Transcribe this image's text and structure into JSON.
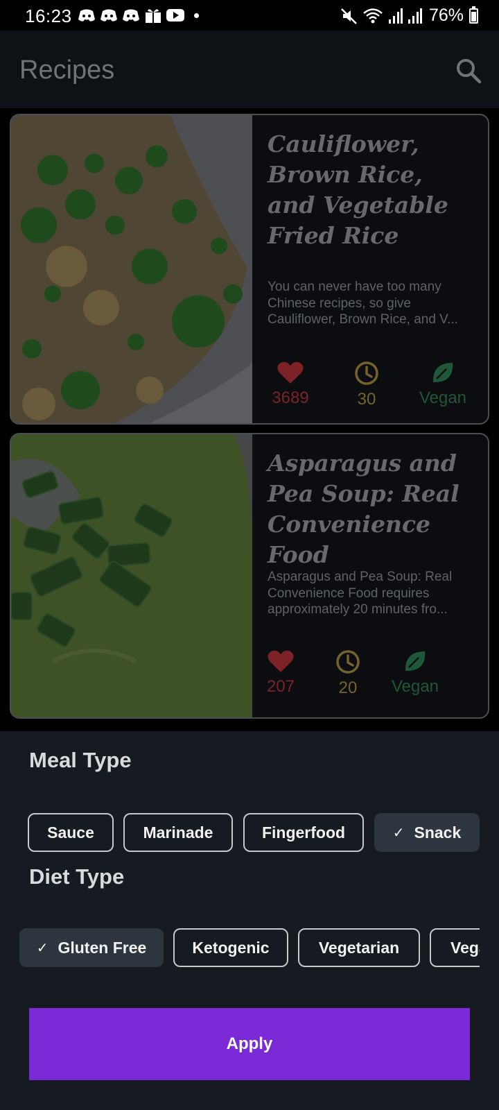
{
  "status_bar": {
    "time": "16:23",
    "battery": "76%",
    "icons_left": [
      "discord-icon",
      "discord-icon",
      "discord-icon",
      "gift-icon",
      "youtube-icon",
      "dot-icon"
    ],
    "icons_right": [
      "mute-icon",
      "wifi-icon",
      "signal-icon",
      "signal-icon",
      "battery-icon"
    ]
  },
  "app_bar": {
    "title": "Recipes",
    "search_icon": "search-icon"
  },
  "recipes": [
    {
      "title": "Cauliflower, Brown Rice, and Vegetable Fried Rice",
      "description": "You can never have too many Chinese recipes, so give Cauliflower, Brown Rice, and V...",
      "desc_lines": [
        "You can never have too many",
        "Chinese recipes, so give",
        "Cauliflower, Brown Rice, and V..."
      ],
      "likes": "3689",
      "minutes": "30",
      "diet": "Vegan"
    },
    {
      "title": "Asparagus and Pea Soup: Real Convenience Food",
      "description": "Asparagus and Pea Soup: Real Convenience Food requires approximately 20 minutes fro...",
      "desc_lines": [
        "Asparagus and Pea Soup: Real",
        "Convenience Food requires",
        "approximately 20 minutes fro..."
      ],
      "likes": "207",
      "minutes": "20",
      "diet": "Vegan"
    }
  ],
  "filter_sheet": {
    "meal_type_title": "Meal Type",
    "meal_types": [
      {
        "label": "Sauce",
        "selected": false
      },
      {
        "label": "Marinade",
        "selected": false
      },
      {
        "label": "Fingerfood",
        "selected": false
      },
      {
        "label": "Snack",
        "selected": true
      }
    ],
    "diet_type_title": "Diet Type",
    "diet_types": [
      {
        "label": "Gluten Free",
        "selected": true
      },
      {
        "label": "Ketogenic",
        "selected": false
      },
      {
        "label": "Vegetarian",
        "selected": false
      },
      {
        "label": "Vegan",
        "selected": false
      }
    ],
    "apply_label": "Apply"
  },
  "colors": {
    "accent": "#7929d6",
    "likes": "#7d2227",
    "time": "#77622a",
    "vegan": "#1e5839",
    "sheet_bg": "#161b22"
  }
}
